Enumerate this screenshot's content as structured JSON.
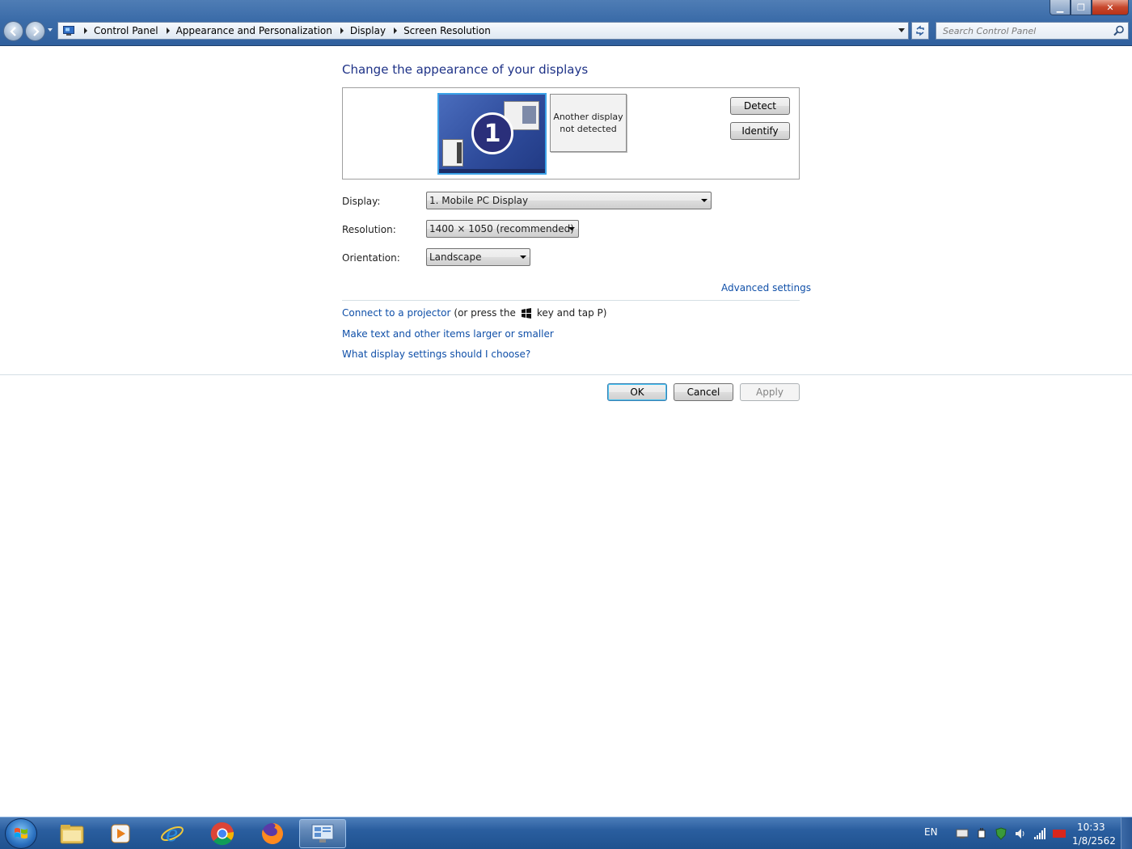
{
  "window": {
    "breadcrumbs": [
      "Control Panel",
      "Appearance and Personalization",
      "Display",
      "Screen Resolution"
    ],
    "search_placeholder": "Search Control Panel",
    "controls": [
      "minimize-icon",
      "maximize-icon",
      "close-icon"
    ]
  },
  "main": {
    "heading": "Change the appearance of your displays",
    "preview": {
      "display_number": "1",
      "other_display": "Another display not detected",
      "detect_label": "Detect",
      "identify_label": "Identify"
    },
    "fields": {
      "display_label": "Display:",
      "display_value": "1. Mobile PC Display",
      "resolution_label": "Resolution:",
      "resolution_value": "1400 × 1050 (recommended)",
      "orientation_label": "Orientation:",
      "orientation_value": "Landscape"
    },
    "advanced_settings": "Advanced settings",
    "links": {
      "projector_link": "Connect to a projector",
      "projector_prefix": "(or press the",
      "projector_suffix": "key and tap P)",
      "text_size": "Make text and other items larger or smaller",
      "help": "What display settings should I choose?"
    },
    "buttons": {
      "ok": "OK",
      "cancel": "Cancel",
      "apply": "Apply",
      "apply_enabled": false
    }
  },
  "taskbar": {
    "pinned": [
      "windows-explorer-icon",
      "media-player-icon",
      "internet-explorer-icon",
      "chrome-icon",
      "firefox-icon",
      "control-panel-icon"
    ],
    "active_item": "control-panel-icon",
    "language": "EN",
    "tray_icons": [
      "action-center-icon",
      "power-icon",
      "security-icon",
      "volume-icon",
      "network-signal-icon",
      "ati-icon"
    ],
    "time": "10:33",
    "date": "1/8/2562"
  },
  "colors": {
    "heading": "#1e3287",
    "link": "#0f4fa8",
    "titlebar": "#3a6ba8",
    "taskbar": "#2a5e9f",
    "monitor_selected": "#3ca3e8"
  }
}
